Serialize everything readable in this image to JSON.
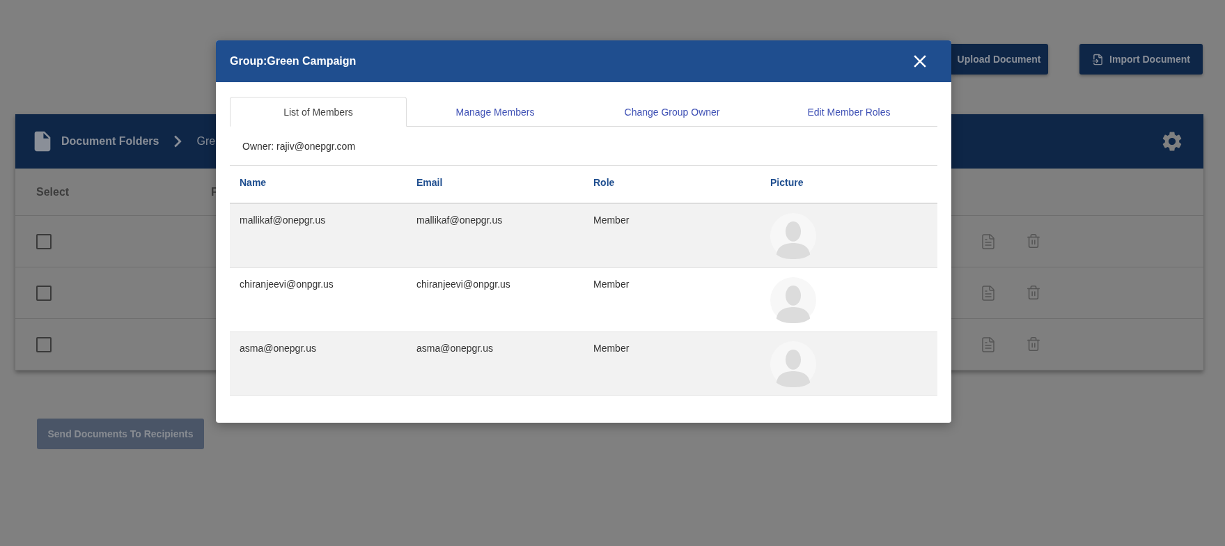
{
  "background": {
    "actions": [
      {
        "kind": "upload",
        "label": "Upload Document"
      },
      {
        "kind": "import",
        "label": "Import Document"
      }
    ],
    "breadcrumb": [
      "Document Folders",
      "Gre"
    ],
    "columns": [
      "Select",
      "F"
    ],
    "rows": [
      {
        "checked": false
      },
      {
        "checked": false
      },
      {
        "checked": false
      }
    ],
    "send_button": "Send Documents To Recipients"
  },
  "modal": {
    "title": "Group:Green Campaign",
    "tabs": [
      {
        "label": "List of Members",
        "selected": true
      },
      {
        "label": "Manage Members",
        "selected": false
      },
      {
        "label": "Change Group Owner",
        "selected": false
      },
      {
        "label": "Edit Member Roles",
        "selected": false
      }
    ],
    "owner": "Owner: rajiv@onepgr.com",
    "table": {
      "columns": [
        "Name",
        "Email",
        "Role",
        "Picture"
      ],
      "rows": [
        {
          "name": "mallikaf@onepgr.us",
          "email": "mallikaf@onepgr.us",
          "role": "Member"
        },
        {
          "name": "chiranjeevi@onpgr.us",
          "email": "chiranjeevi@onpgr.us",
          "role": "Member"
        },
        {
          "name": "asma@onepgr.us",
          "email": "asma@onepgr.us",
          "role": "Member"
        }
      ]
    }
  }
}
